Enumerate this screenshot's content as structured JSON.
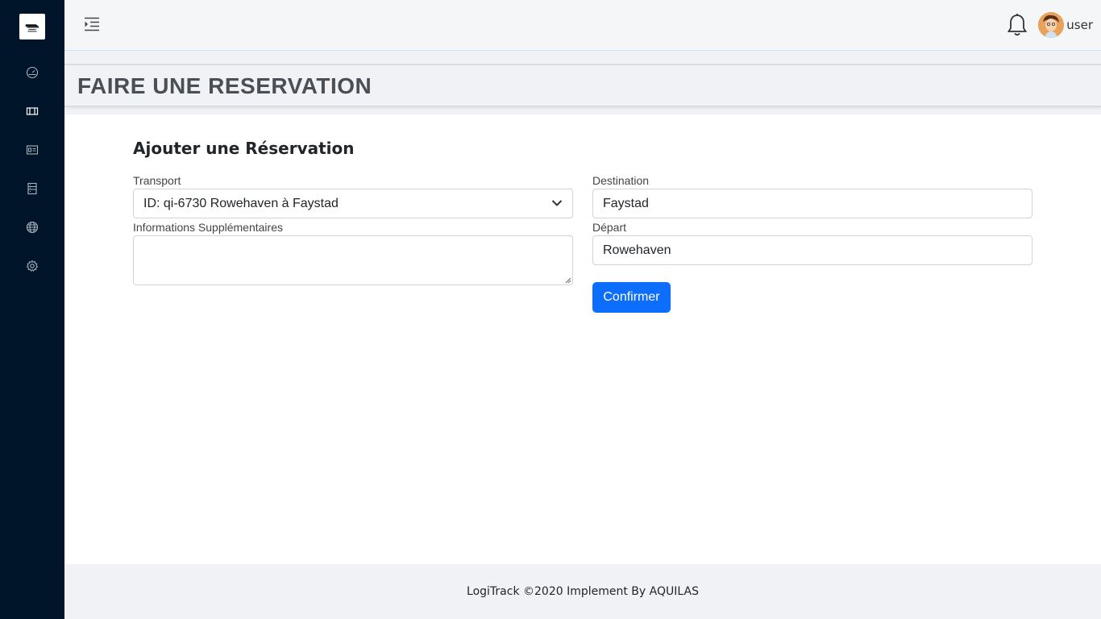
{
  "app": {
    "name": "LogiTrack"
  },
  "sidebar": {
    "items": [
      {
        "icon": "dashboard-icon",
        "active": false
      },
      {
        "icon": "ticket-icon",
        "active": true
      },
      {
        "icon": "id-card-icon",
        "active": false
      },
      {
        "icon": "list-icon",
        "active": false
      },
      {
        "icon": "globe-icon",
        "active": false
      },
      {
        "icon": "gear-icon",
        "active": false
      }
    ]
  },
  "topbar": {
    "username": "user"
  },
  "page": {
    "title": "FAIRE UNE RESERVATION"
  },
  "form": {
    "title": "Ajouter une Réservation",
    "transport_label": "Transport",
    "transport_value": "ID: qi-6730 Rowehaven à Faystad",
    "info_label": "Informations Supplémentaires",
    "info_value": "",
    "destination_label": "Destination",
    "destination_value": "Faystad",
    "depart_label": "Départ",
    "depart_value": "Rowehaven",
    "confirm_label": "Confirmer"
  },
  "footer": {
    "text": "LogiTrack ©2020 Implement By AQUILAS"
  },
  "colors": {
    "sidebar": "#001529",
    "primary": "#0d6efd",
    "page_bg": "#f0f2f5"
  }
}
